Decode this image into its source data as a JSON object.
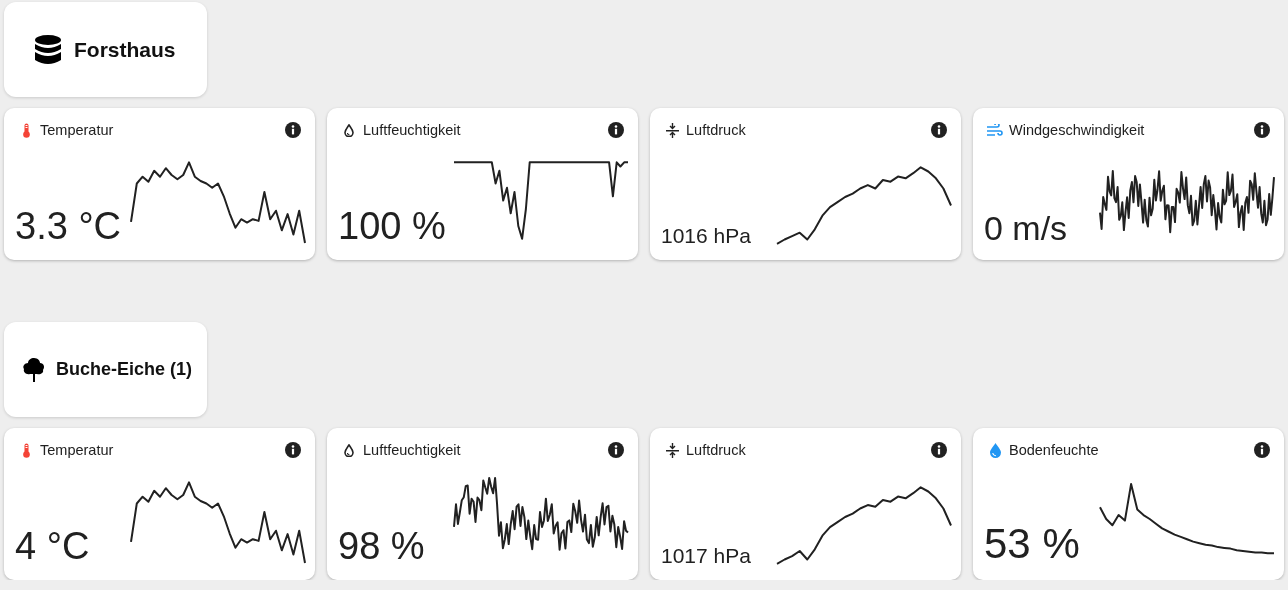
{
  "groups": [
    {
      "title": "Forsthaus",
      "kind": "database",
      "sensors": [
        {
          "kind": "temperature",
          "label": "Temperatur",
          "value": "3.3 °C"
        },
        {
          "kind": "humidity",
          "label": "Luftfeuchtigkeit",
          "value": "100 %"
        },
        {
          "kind": "pressure",
          "label": "Luftdruck",
          "value": "1016 hPa"
        },
        {
          "kind": "wind",
          "label": "Windgeschwindigkeit",
          "value": "0 m/s"
        }
      ]
    },
    {
      "title": "Buche-Eiche (1)",
      "kind": "tree",
      "sensors": [
        {
          "kind": "temperature",
          "label": "Temperatur",
          "value": "4 °C"
        },
        {
          "kind": "humidity",
          "label": "Luftfeuchtigkeit",
          "value": "98 %"
        },
        {
          "kind": "pressure",
          "label": "Luftdruck",
          "value": "1017 hPa"
        },
        {
          "kind": "soil",
          "label": "Bodenfeuchte",
          "value": "53 %"
        }
      ]
    }
  ]
}
